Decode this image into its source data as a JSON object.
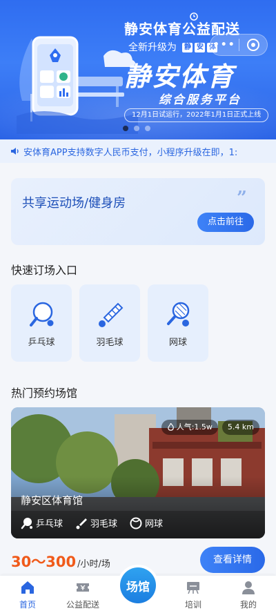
{
  "banner": {
    "small_title": "静安体育公益配送",
    "upgrade_text": "全新升级为",
    "upgrade_badges": [
      "静",
      "安",
      "体"
    ],
    "big_title": "静安体育",
    "sub_title": "综合服务平台",
    "date_text": "12月1日试运行，2022年1月1日正式上线",
    "capsule_more": "•••",
    "slide_count": 3,
    "active_slide": 1
  },
  "notice": {
    "text": "安体育APP支持数字人民币支付，小程序升级在即，1:"
  },
  "shared_card": {
    "title": "共享运动场/健身房",
    "quote": "”",
    "button_label": "点击前往"
  },
  "quick_section": {
    "title": "快速订场入口",
    "items": [
      {
        "label": "乒乓球",
        "icon": "ping-pong-icon"
      },
      {
        "label": "羽毛球",
        "icon": "badminton-icon"
      },
      {
        "label": "网球",
        "icon": "tennis-icon"
      }
    ]
  },
  "hot_section": {
    "title": "热门预约场馆",
    "venue": {
      "name": "静安区体育馆",
      "popularity": "人气:1.5w",
      "distance": "5.4 km",
      "tags": [
        {
          "label": "乒乓球",
          "icon": "ping-pong-icon"
        },
        {
          "label": "羽毛球",
          "icon": "badminton-icon"
        },
        {
          "label": "网球",
          "icon": "tennis-icon"
        }
      ]
    },
    "price_range": "30～300",
    "price_unit": "/小时/场",
    "detail_button": "查看详情"
  },
  "tabbar": {
    "tabs": [
      {
        "label": "首页",
        "icon": "home-icon",
        "active": true
      },
      {
        "label": "公益配送",
        "icon": "ticket-icon",
        "active": false
      },
      {
        "label": "场馆",
        "icon": "venue-icon",
        "active": false
      },
      {
        "label": "培训",
        "icon": "training-board-icon",
        "active": false
      },
      {
        "label": "我的",
        "icon": "user-icon",
        "active": false
      }
    ]
  },
  "colors": {
    "accent": "#2a66e0",
    "price": "#f05a1a",
    "banner": "#2f6df0"
  }
}
